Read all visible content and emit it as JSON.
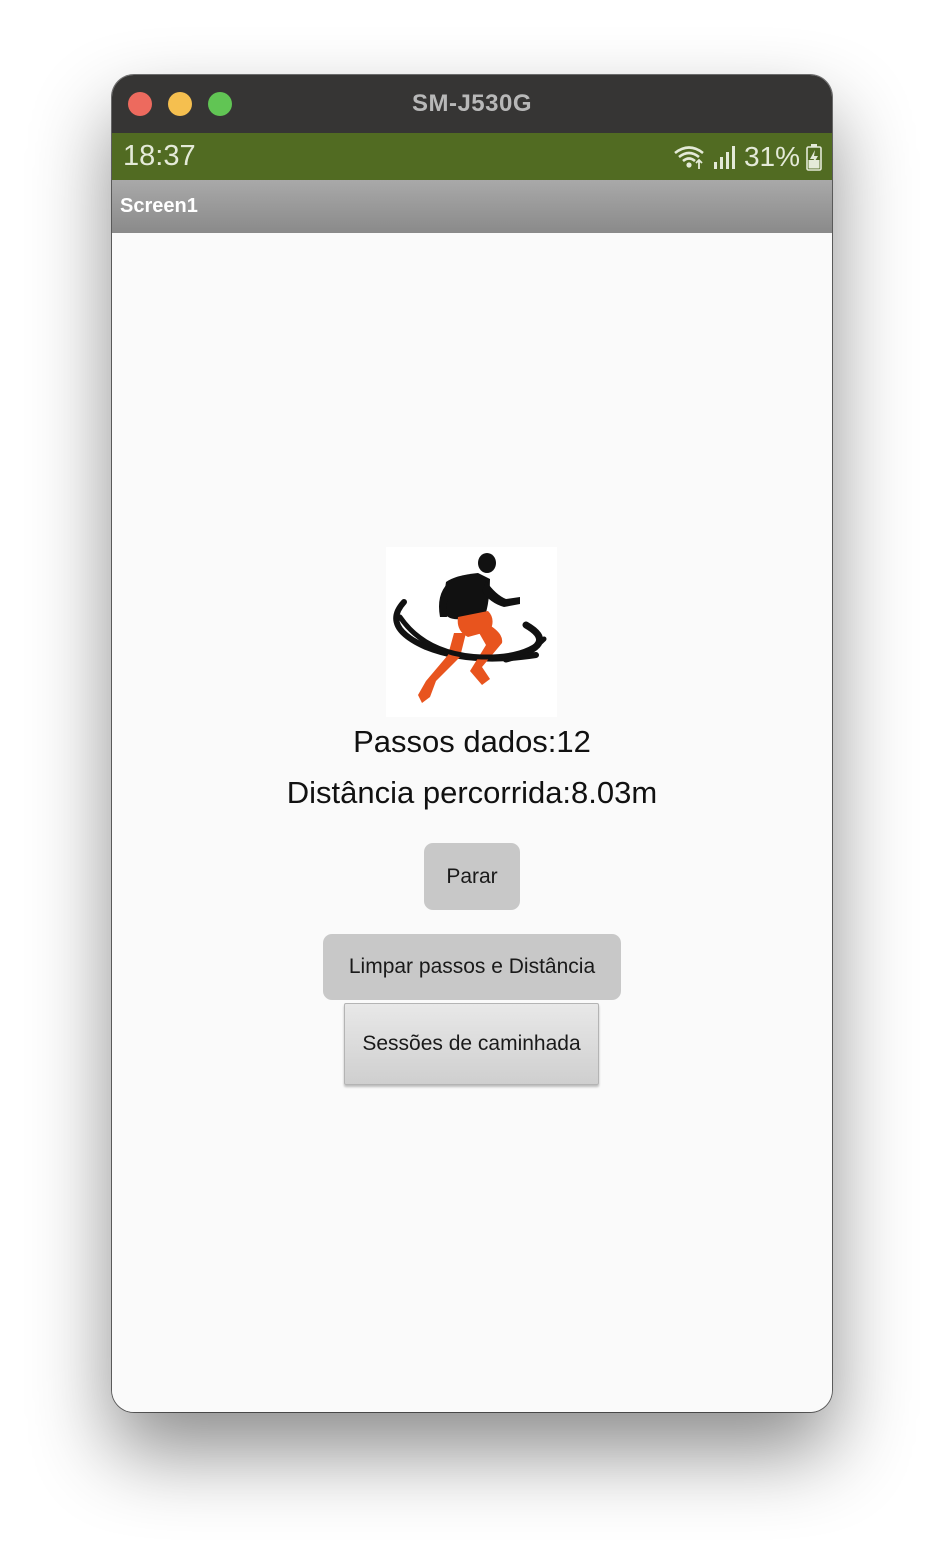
{
  "window": {
    "title": "SM-J530G"
  },
  "status_bar": {
    "time": "18:37",
    "battery_text": "31%",
    "icons": [
      "wifi-icon",
      "signal-icon",
      "battery-charging-icon"
    ],
    "background": "#516b22"
  },
  "action_bar": {
    "title": "Screen1"
  },
  "main": {
    "image": "runner-logo",
    "steps_text": "Passos dados:12",
    "distance_text": "Distância percorrida:8.03m",
    "buttons": {
      "stop_label": "Parar",
      "clear_label": "Limpar passos e Distância",
      "sessions_label": "Sessões de caminhada"
    }
  },
  "colors": {
    "runner_shorts": "#e8541e",
    "runner_body": "#111111"
  }
}
